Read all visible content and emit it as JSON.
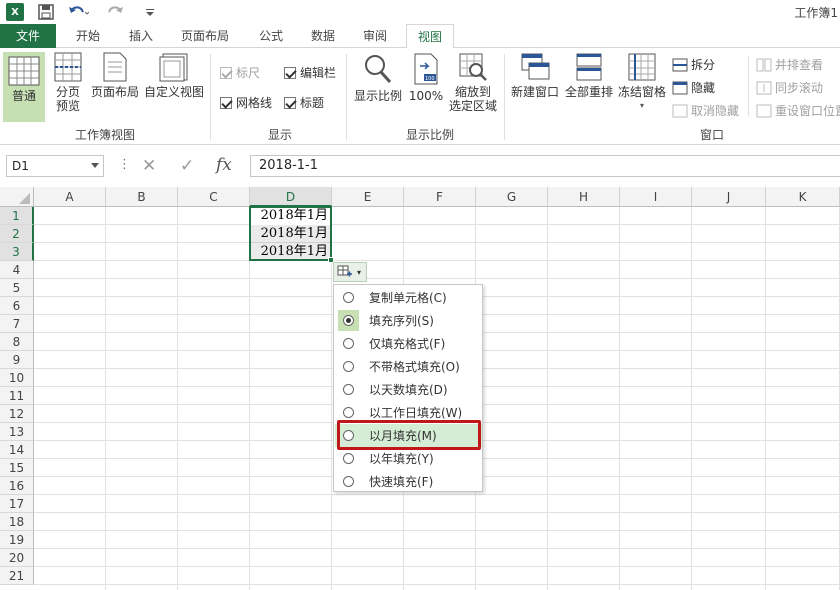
{
  "window": {
    "title": "工作簿1"
  },
  "quick_access": {
    "excel_logo": "X",
    "save_icon": "save-icon",
    "undo_icon": "undo-icon",
    "redo_icon": "redo-icon",
    "customize_icon": "customize-qat-icon"
  },
  "tabs": {
    "file": "文件",
    "items": [
      "开始",
      "插入",
      "页面布局",
      "公式",
      "数据",
      "审阅",
      "视图"
    ],
    "active": "视图"
  },
  "ribbon": {
    "workbook_views": {
      "normal": "普通",
      "page_break_line1": "分页",
      "page_break_line2": "预览",
      "page_layout": "页面布局",
      "custom_views": "自定义视图",
      "group_label": "工作簿视图"
    },
    "show": {
      "ruler": "标尺",
      "formula_bar": "编辑栏",
      "gridlines": "网格线",
      "headings": "标题",
      "group_label": "显示"
    },
    "zoom": {
      "zoom": "显示比例",
      "hundred": "100%",
      "selection_line1": "缩放到",
      "selection_line2": "选定区域",
      "group_label": "显示比例"
    },
    "window": {
      "new_window": "新建窗口",
      "arrange_all": "全部重排",
      "freeze_panes": "冻结窗格",
      "split": "拆分",
      "hide": "隐藏",
      "unhide": "取消隐藏",
      "side_by_side": "并排查看",
      "sync_scroll": "同步滚动",
      "reset_position": "重设窗口位置",
      "group_label": "窗口"
    }
  },
  "formula_bar": {
    "name_box": "D1",
    "cancel": "✕",
    "enter": "✓",
    "fx": "fx",
    "formula": "2018-1-1"
  },
  "grid": {
    "columns": [
      "A",
      "B",
      "C",
      "D",
      "E",
      "F",
      "G",
      "H",
      "I",
      "J",
      "K"
    ],
    "active_column": "D",
    "rows": [
      "1",
      "2",
      "3",
      "4",
      "5",
      "6",
      "7",
      "8",
      "9",
      "10",
      "11",
      "12",
      "13",
      "14",
      "15",
      "16",
      "17",
      "18",
      "19",
      "20",
      "21"
    ],
    "cells": {
      "D1": "2018年1月",
      "D2": "2018年1月",
      "D3": "2018年1月"
    }
  },
  "autofill_menu": {
    "items": [
      "复制单元格(C)",
      "填充序列(S)",
      "仅填充格式(F)",
      "不带格式填充(O)",
      "以天数填充(D)",
      "以工作日填充(W)",
      "以月填充(M)",
      "以年填充(Y)",
      "快速填充(F)"
    ],
    "checked": "填充序列(S)",
    "highlighted": "以月填充(M)",
    "highlight_color": "#c01818"
  },
  "colors": {
    "brand": "#217346",
    "selected": "#c6e0b4"
  }
}
